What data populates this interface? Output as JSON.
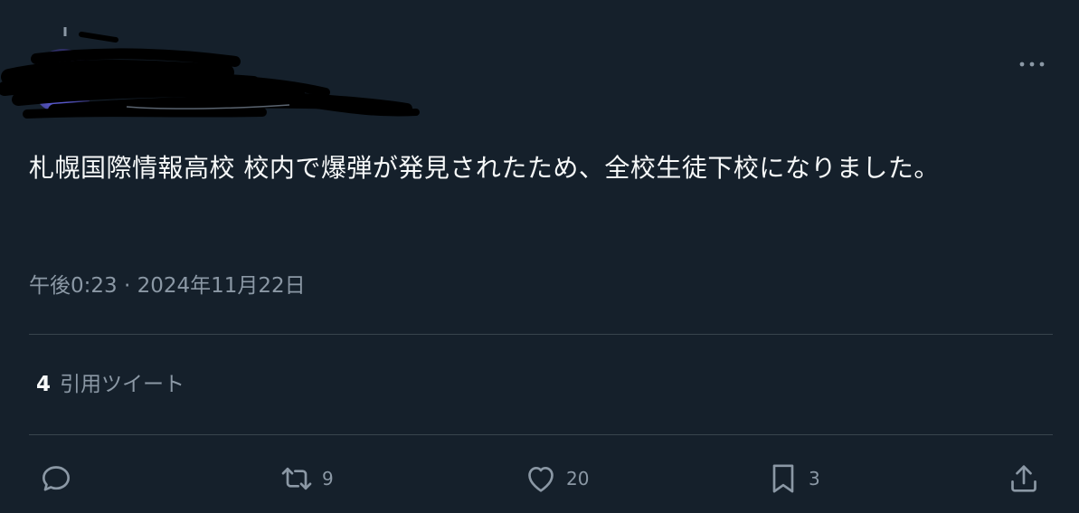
{
  "author": {
    "display_name": "",
    "handle": ""
  },
  "tweet": {
    "text": "札幌国際情報高校 校内で爆弾が発見されたため、全校生徒下校になりました。",
    "timestamp": "午後0:23 · 2024年11月22日"
  },
  "quotes": {
    "count": "4",
    "label": "引用ツイート"
  },
  "actions": {
    "reply_icon": "reply-icon",
    "retweet_icon": "retweet-icon",
    "retweet_count": "9",
    "like_icon": "heart-icon",
    "like_count": "20",
    "bookmark_icon": "bookmark-icon",
    "bookmark_count": "3",
    "share_icon": "share-icon"
  },
  "colors": {
    "background": "#15202b",
    "text_primary": "#f7f9f9",
    "text_secondary": "#8b98a5",
    "divider": "#38444d"
  }
}
